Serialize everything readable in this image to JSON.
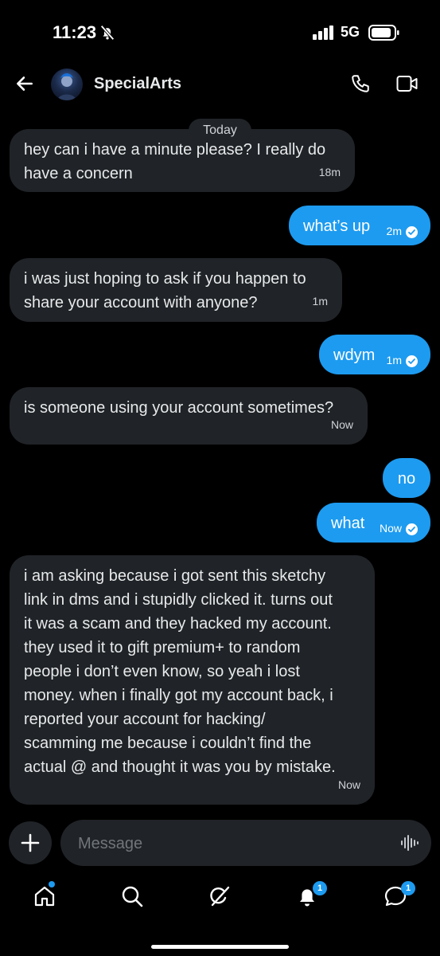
{
  "status_bar": {
    "time": "11:23",
    "network": "5G"
  },
  "header": {
    "username": "SpecialArts"
  },
  "date_separator": "Today",
  "messages": [
    {
      "dir": "in",
      "text": "hey can i have a minute please? I really do\nhave a concern",
      "time": "18m"
    },
    {
      "dir": "out",
      "text": "what’s up",
      "time": "2m",
      "read": true
    },
    {
      "dir": "in",
      "text": "i was just hoping to ask if you happen to\nshare your account with anyone?",
      "time": "1m"
    },
    {
      "dir": "out",
      "text": "wdym",
      "time": "1m",
      "read": true
    },
    {
      "dir": "in",
      "text": "is someone using your account sometimes?",
      "time": "Now"
    },
    {
      "dir": "out",
      "text": "no"
    },
    {
      "dir": "out",
      "text": "what",
      "time": "Now",
      "read": true
    },
    {
      "dir": "in",
      "text": "i am asking because i got sent this sketchy\nlink in dms and i stupidly clicked it. turns out\nit was a scam and they hacked my account.\nthey used it to gift premium+ to random\npeople i don’t even know, so yeah i lost\nmoney. when i finally got my account back, i\nreported your account for hacking/\nscamming me because i couldn’t find the\nactual @ and thought it was you by mistake.",
      "time": "Now"
    }
  ],
  "composer": {
    "placeholder": "Message"
  },
  "nav": {
    "icons": [
      "home-icon",
      "search-icon",
      "grok-icon",
      "notifications-icon",
      "messages-icon"
    ],
    "notifications_badge": "1",
    "messages_badge": "1"
  },
  "colors": {
    "accent": "#1d9bf0",
    "bubble_in": "#202327",
    "background": "#000000"
  }
}
